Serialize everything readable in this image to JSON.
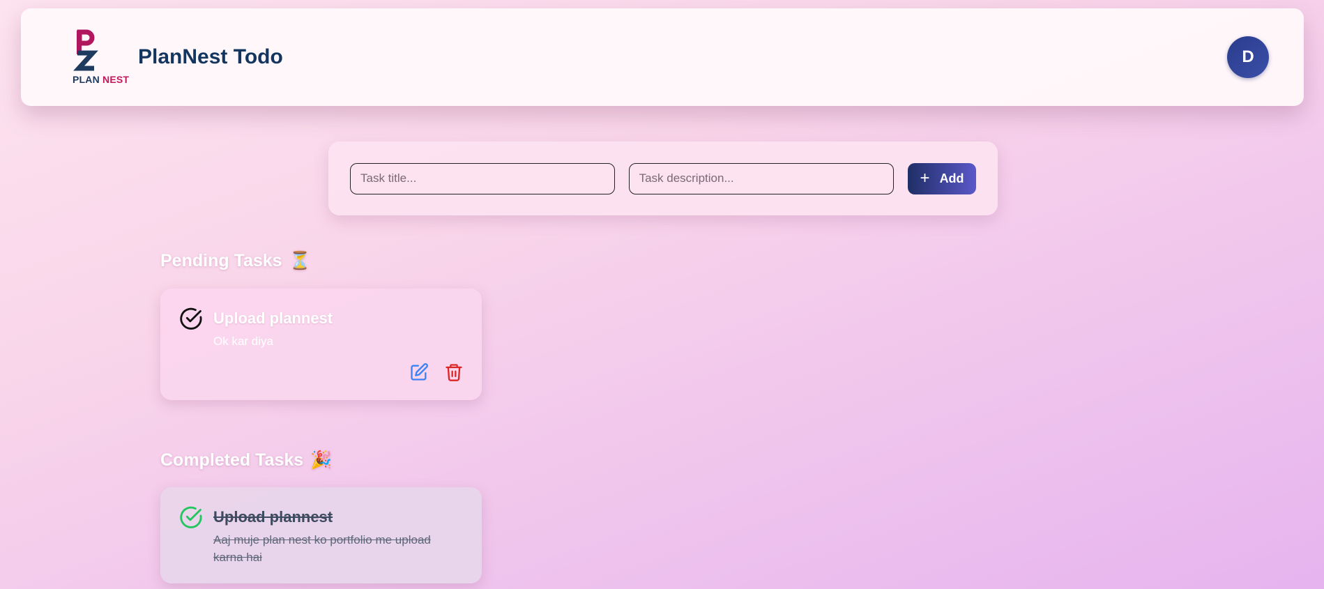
{
  "header": {
    "logo_text_plan": "PLAN",
    "logo_text_nest": "NEST",
    "brand": "PlanNest Todo",
    "avatar_initial": "D"
  },
  "add_form": {
    "title_placeholder": "Task title...",
    "description_placeholder": "Task description...",
    "add_label": "Add",
    "add_icon": "plus-icon"
  },
  "pending": {
    "heading": "Pending Tasks",
    "heading_emoji": "⏳",
    "tasks": [
      {
        "title": "Upload plannest",
        "description": "Ok kar diya",
        "status_icon": "check-circle-icon",
        "edit_icon": "edit-icon",
        "delete_icon": "trash-icon"
      }
    ]
  },
  "completed": {
    "heading": "Completed Tasks",
    "heading_emoji": "🎉",
    "tasks": [
      {
        "title": "Upload plannest",
        "description": "Aaj muje plan nest ko portfolio me upload karna hai",
        "status_icon": "check-circle-icon"
      }
    ]
  },
  "colors": {
    "brand_navy": "#14365e",
    "brand_magenta": "#c2185b",
    "edit_blue": "#3b82f6",
    "delete_red": "#dc2626",
    "done_green": "#22c55e"
  }
}
